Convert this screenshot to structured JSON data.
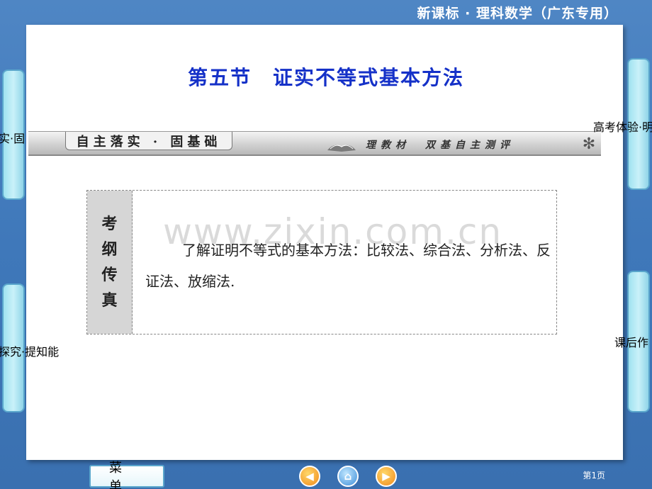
{
  "header": {
    "title": "新课标 · 理科数学（广东专用）"
  },
  "section": {
    "title": "第五节　证实不等式基本方法"
  },
  "banner": {
    "left_label": "自主落实 · 固基础",
    "right_label": "理教材　双基自主测评"
  },
  "left_tabs": {
    "upper_label": "落实·固",
    "lower_label": "探究·提知能"
  },
  "right_tabs": {
    "upper_label": "高考体验·明",
    "lower_label": "课后作"
  },
  "content": {
    "side_label": [
      "考",
      "纲",
      "传",
      "真"
    ],
    "text": "了解证明不等式的基本方法：比较法、综合法、分析法、反证法、放缩法."
  },
  "watermark": "www.zixin.com.cn",
  "footer": {
    "menu_label": "菜单",
    "page_number": "第1页"
  },
  "colors": {
    "background": "#3f78ba",
    "title_blue": "#1531c8",
    "tab_fill": "#c9f1f9"
  }
}
